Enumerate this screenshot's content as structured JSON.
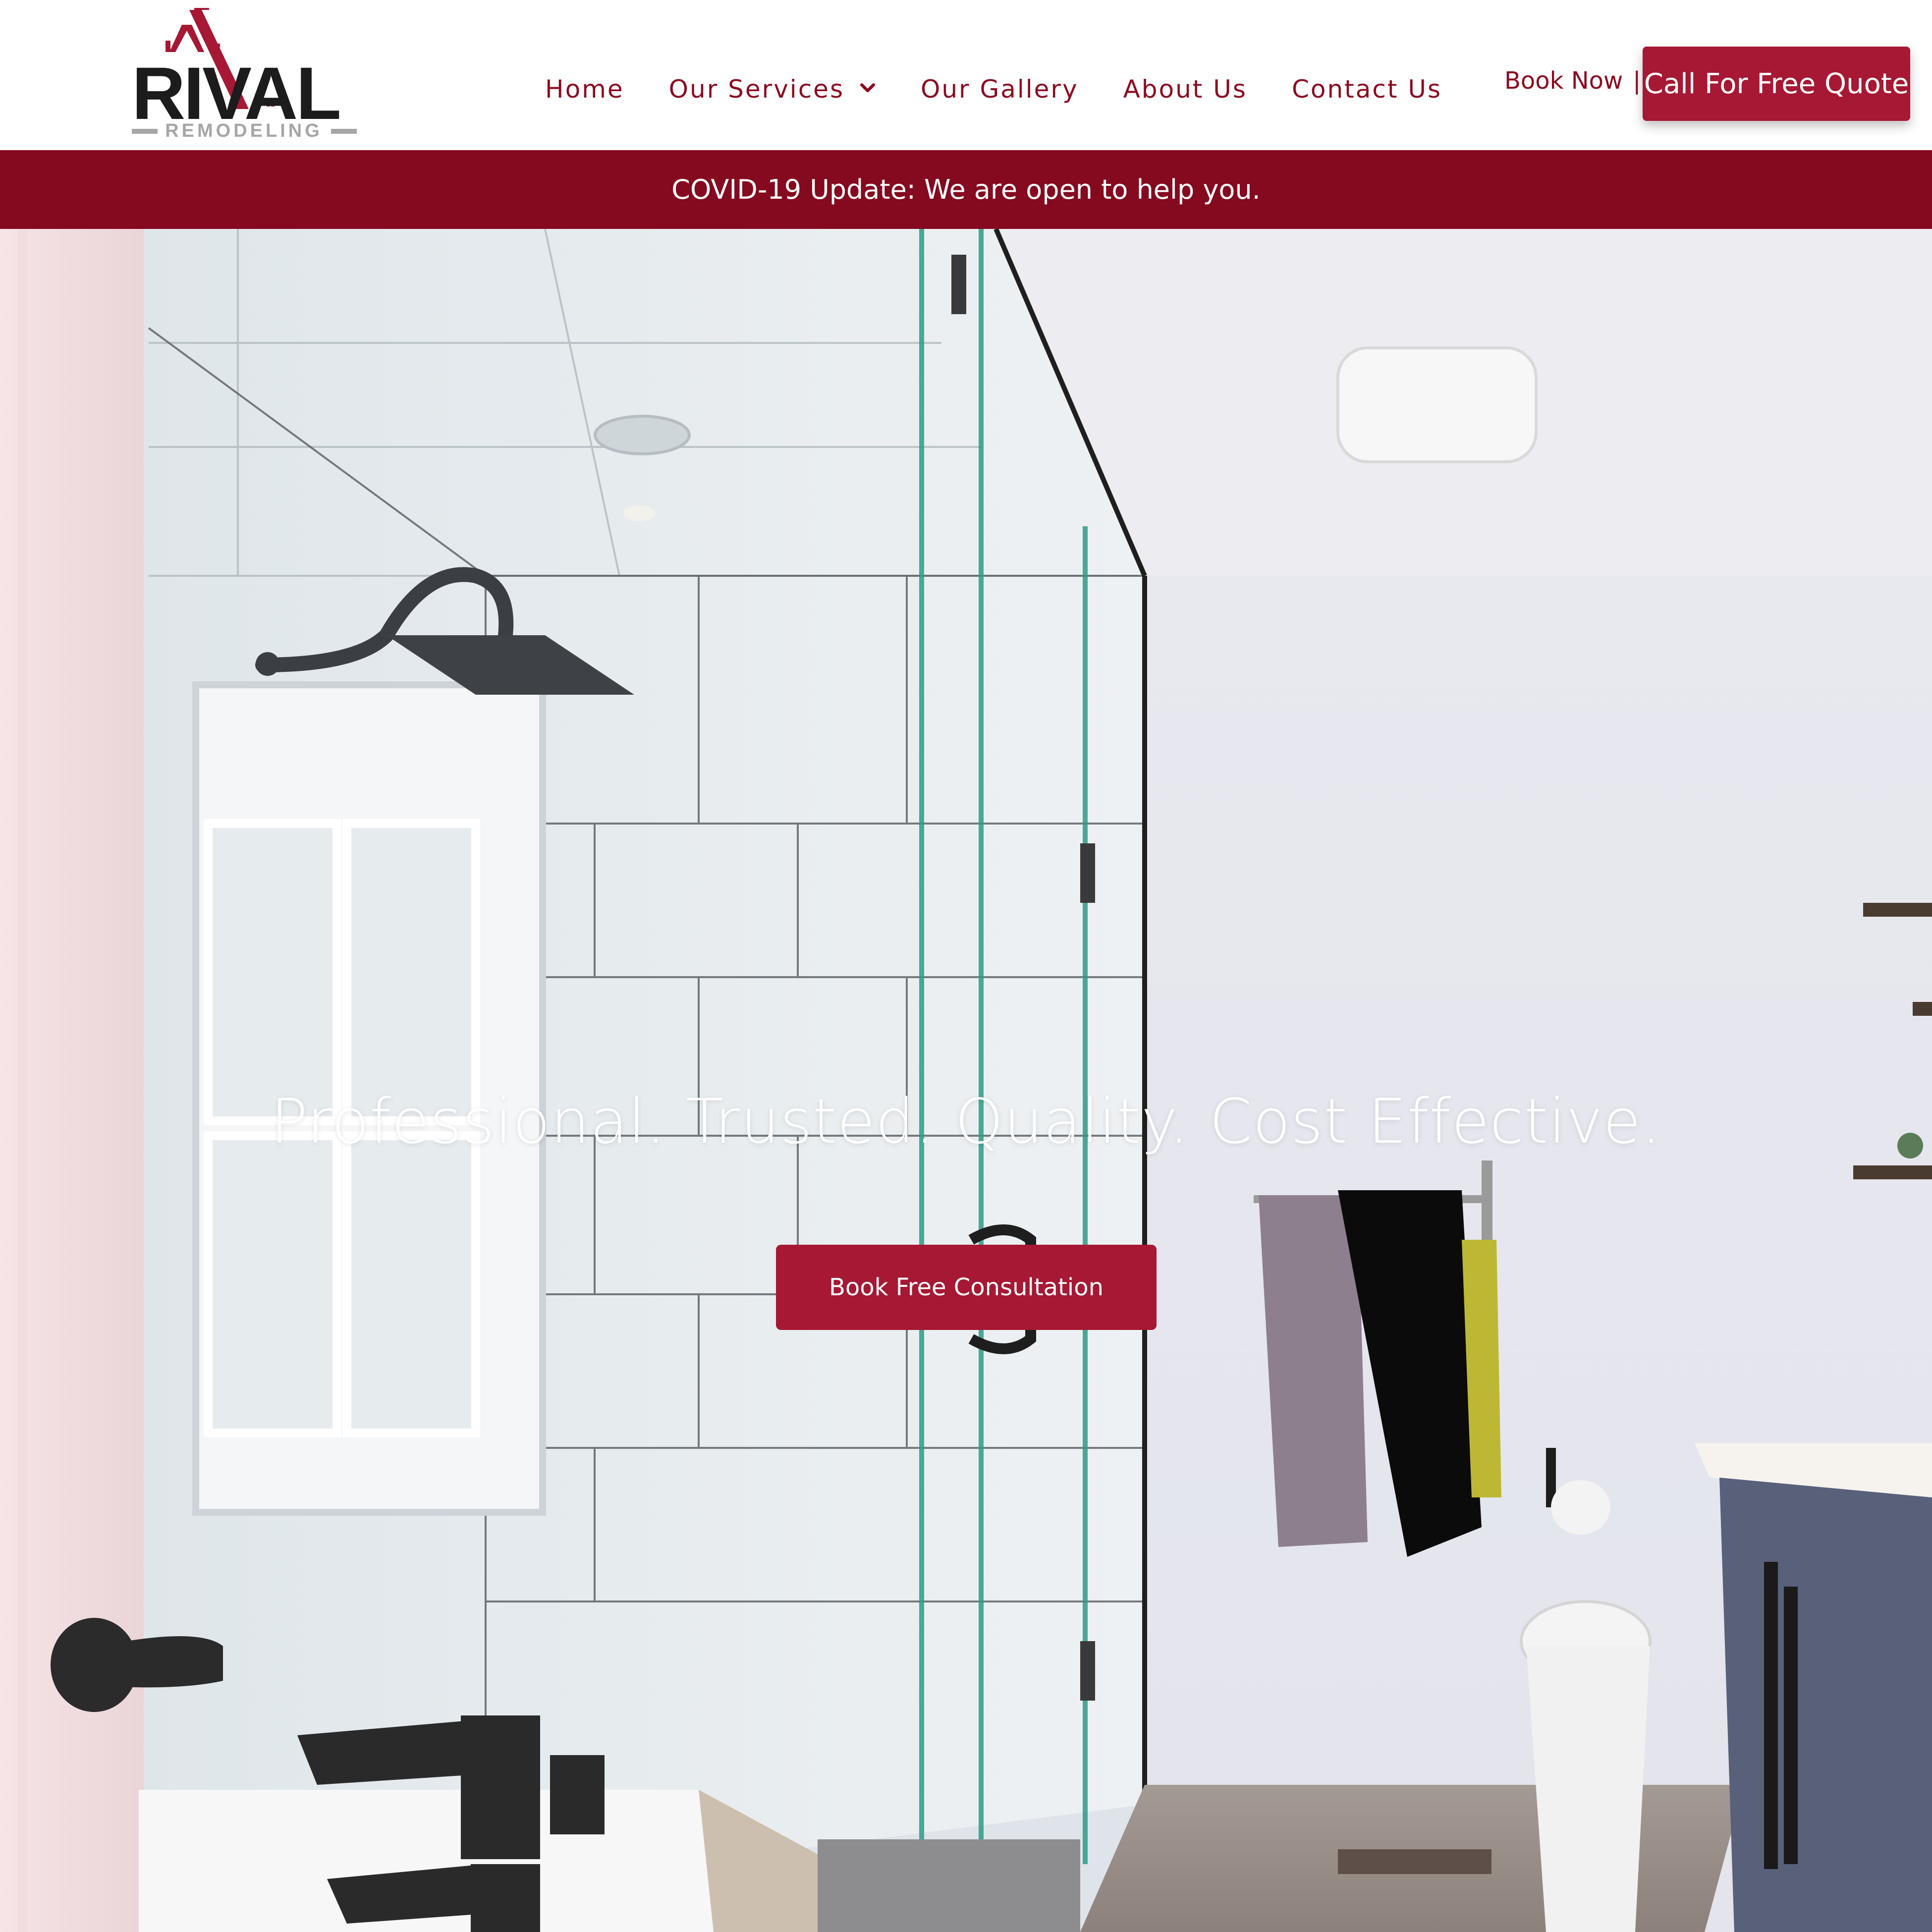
{
  "brand": {
    "logo_main": "RIVAL",
    "logo_sub": "REMODELING",
    "color_primary": "#a61833",
    "color_dark": "#85091f",
    "color_text": "#8b0a1f"
  },
  "nav": {
    "items": [
      {
        "label": "Home"
      },
      {
        "label": "Our Services",
        "has_dropdown": true,
        "icon": "chevron-down-icon"
      },
      {
        "label": "Our Gallery"
      },
      {
        "label": "About Us"
      },
      {
        "label": "Contact Us"
      }
    ]
  },
  "header_actions": {
    "book_now_label": "Book Now",
    "separator": "|",
    "quote_label": "Call For Free Quote"
  },
  "announcement": {
    "text": "COVID-19 Update: We are open to help you."
  },
  "hero": {
    "tagline": "Professional. Trusted. Quality. Cost Effective.",
    "cta_label": "Book Free Consultation"
  }
}
